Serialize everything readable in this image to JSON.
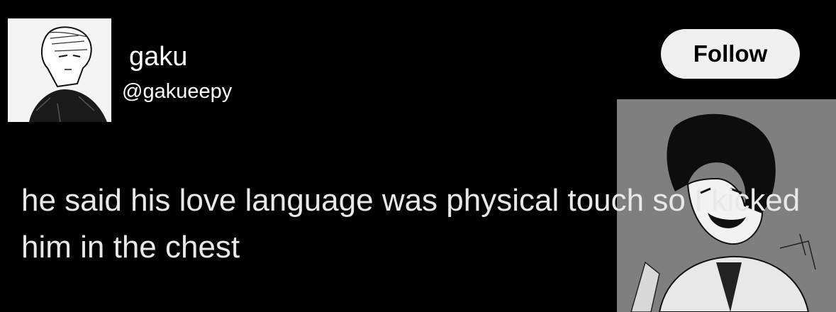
{
  "author": {
    "display_name": "gaku",
    "handle": "@gakueepy",
    "avatar_icon": "manga-portrait-avatar"
  },
  "follow_button": {
    "label": "Follow"
  },
  "tweet": {
    "text": "he said his love language was physical touch so I kicked him in the chest"
  },
  "attached_image": {
    "icon": "manga-laughing-character-image"
  },
  "colors": {
    "background": "#000000",
    "text": "#ffffff",
    "button_bg": "#f0f0f0",
    "button_text": "#000000",
    "image_bg": "#7f7f7f"
  }
}
